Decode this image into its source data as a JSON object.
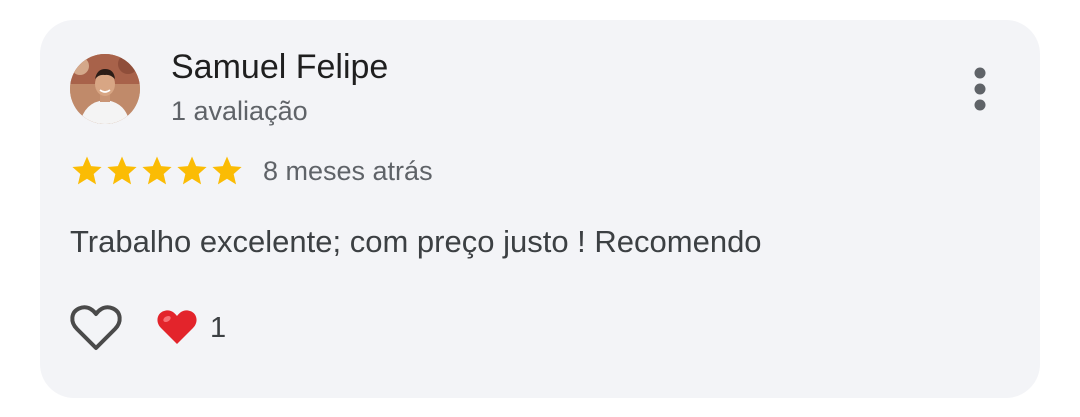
{
  "review": {
    "author": {
      "name": "Samuel Felipe",
      "review_count": "1 avaliação",
      "avatar": "profile-photo"
    },
    "rating": {
      "stars": 5,
      "max": 5,
      "color": "#fbbc04"
    },
    "date": "8 meses atrás",
    "text": "Trabalho excelente; com preço justo ! Recomendo",
    "reactions": {
      "like_icon": "heart-outline-icon",
      "emoji": "red-heart",
      "count": "1"
    },
    "menu_icon": "more-vert-icon"
  },
  "colors": {
    "card_background": "#f3f4f7",
    "star": "#fbbc04",
    "heart": "#e3242b",
    "primary_text": "#1f1f1f",
    "secondary_text": "#5f6368"
  }
}
